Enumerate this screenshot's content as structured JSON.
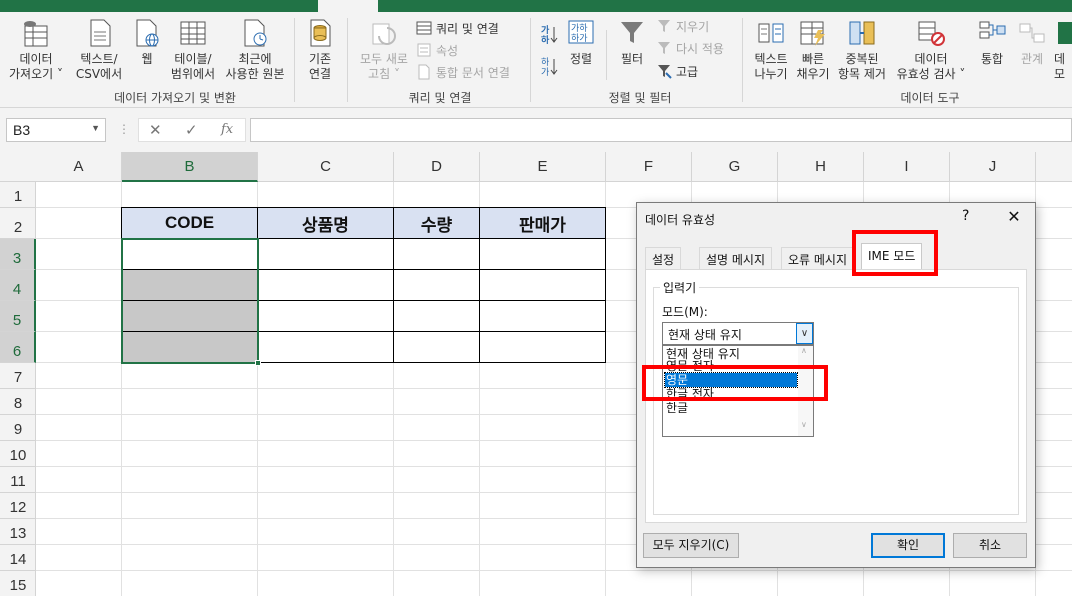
{
  "ribbon": {
    "get_data_label": "데이터\n가져오기 ˅",
    "text_csv_label": "텍스트/\nCSV에서",
    "web_label": "웹",
    "table_range_label": "테이블/\n범위에서",
    "recent_sources_label": "최근에\n사용한 원본",
    "existing_conn_label": "기존\n연결",
    "group_get_transform": "데이터 가져오기 및 변환",
    "refresh_all_label": "모두 새로\n고침 ˅",
    "queries_conn_label": "쿼리 및 연결",
    "properties_label": "속성",
    "edit_links_label": "통합 문서 연결",
    "group_queries": "쿼리 및 연결",
    "sort_label": "정렬",
    "filter_label": "필터",
    "clear_label": "지우기",
    "reapply_label": "다시 적용",
    "advanced_label": "고급",
    "group_sort_filter": "정렬 및 필터",
    "text_to_columns_label": "텍스트\n나누기",
    "flash_fill_label": "빠른\n채우기",
    "remove_dup_label": "중복된\n항목 제거",
    "data_validation_label": "데이터\n유효성 검사 ˅",
    "consolidate_label": "통합",
    "relationships_label": "관계",
    "data_model_label": "데\n모",
    "group_data_tools": "데이터 도구"
  },
  "formula_bar": {
    "name_box": "B3",
    "cancel_icon": "✕",
    "enter_icon": "✓",
    "fx_icon": "fx"
  },
  "columns": [
    "A",
    "B",
    "C",
    "D",
    "E",
    "F",
    "G",
    "H",
    "I",
    "J"
  ],
  "rows": [
    "1",
    "2",
    "3",
    "4",
    "5",
    "6",
    "7",
    "8",
    "9",
    "10",
    "11",
    "12",
    "13",
    "14",
    "15"
  ],
  "table": {
    "headers": [
      "CODE",
      "상품명",
      "수량",
      "판매가"
    ]
  },
  "dialog": {
    "title": "데이터 유효성",
    "help": "?",
    "close": "✕",
    "tabs": [
      "설정",
      "설명 메시지",
      "오류 메시지",
      "IME 모드"
    ],
    "group_title": "입력기",
    "mode_label": "모드(M):",
    "mode_value": "현재 상태 유지",
    "options": [
      "현재 상태 유지",
      "영문 전자",
      "영문",
      "한글 전자",
      "한글"
    ],
    "clear_all_button": "모두 지우기(C)",
    "ok_button": "확인",
    "cancel_button": "취소"
  },
  "colors": {
    "excel_green": "#217346",
    "header_fill": "#d9e1f2",
    "gray_fill": "#c8c8c8",
    "highlight_red": "#ff0000",
    "selection_blue": "#0078d7"
  }
}
